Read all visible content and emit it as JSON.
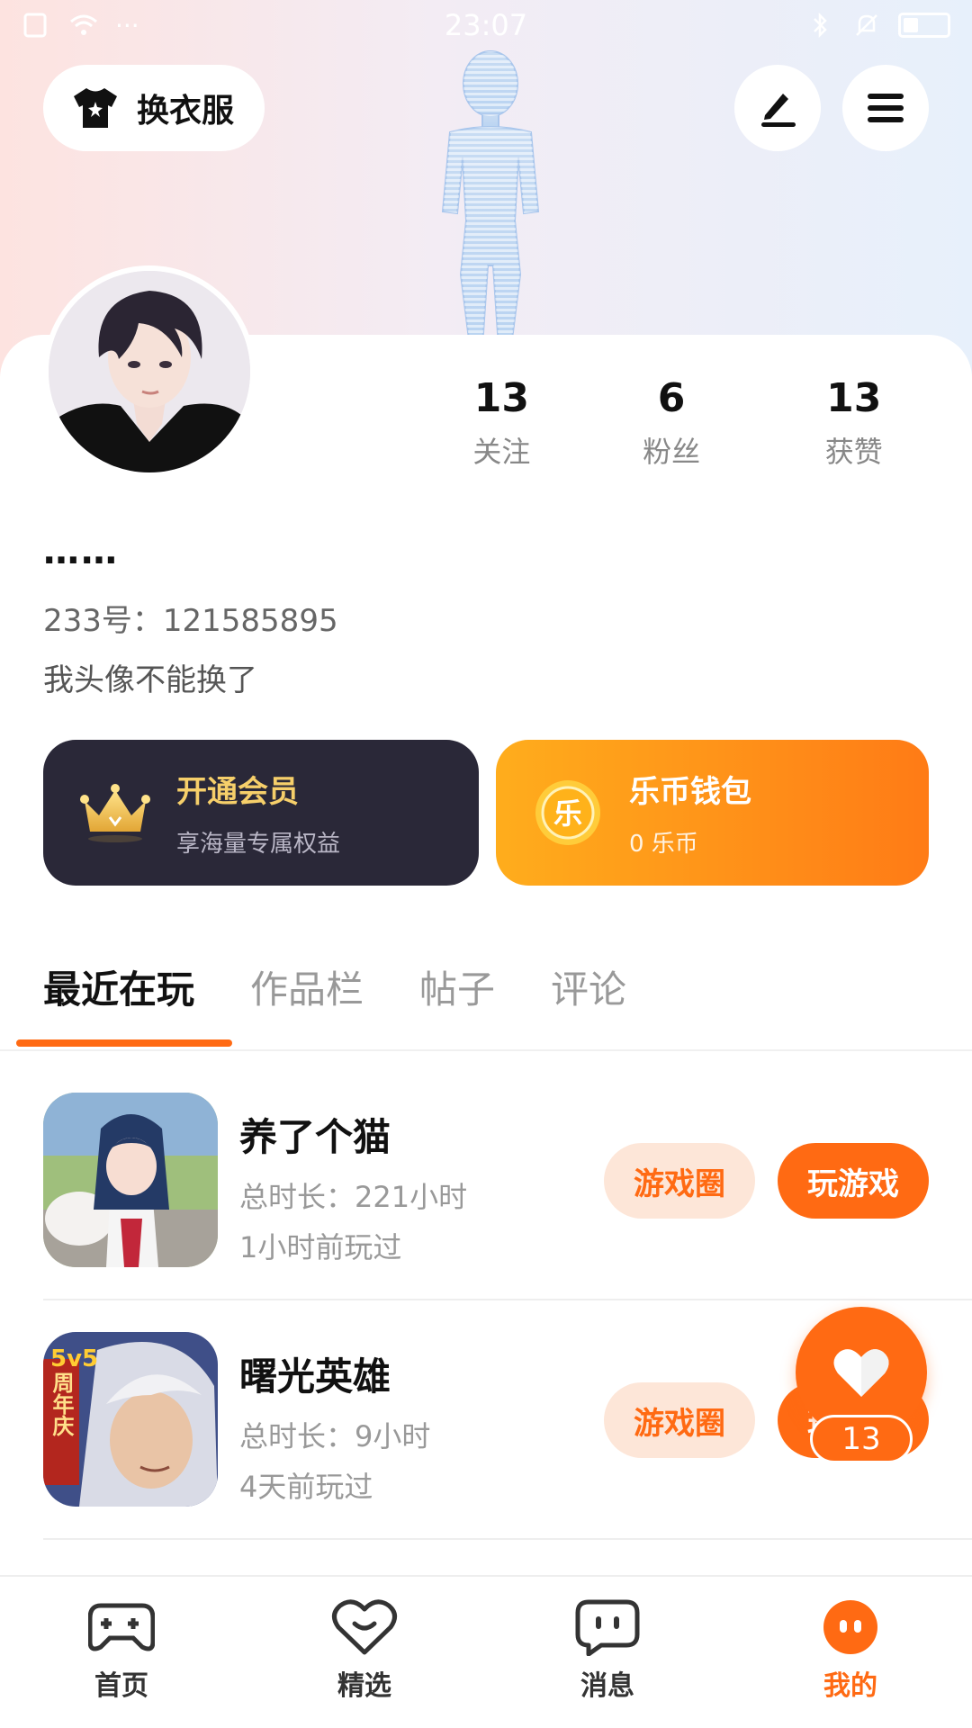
{
  "status_bar": {
    "time": "23:07"
  },
  "top": {
    "outfit_label": "换衣服"
  },
  "stats": [
    {
      "num": "13",
      "label": "关注"
    },
    {
      "num": "6",
      "label": "粉丝"
    },
    {
      "num": "13",
      "label": "获赞"
    }
  ],
  "profile": {
    "nickname": "……",
    "user_id": "233号：121585895",
    "bio": "我头像不能换了"
  },
  "vip_card": {
    "title": "开通会员",
    "subtitle": "享海量专属权益"
  },
  "wallet_card": {
    "title": "乐币钱包",
    "subtitle": "0 乐币",
    "coin_glyph": "乐"
  },
  "tabs": [
    "最近在玩",
    "作品栏",
    "帖子",
    "评论"
  ],
  "games": [
    {
      "name": "养了个猫",
      "duration": "总时长：221小时",
      "last_played": "1小时前玩过",
      "circle_label": "游戏圈",
      "play_label": "玩游戏"
    },
    {
      "name": "曙光英雄",
      "duration": "总时长：9小时",
      "last_played": "4天前玩过",
      "circle_label": "游戏圈",
      "play_label": "玩游戏",
      "icon_badge": "5v5",
      "icon_text": "周年庆"
    }
  ],
  "float_like": {
    "count": "13"
  },
  "nav": [
    {
      "label": "首页",
      "icon": "gamepad-icon"
    },
    {
      "label": "精选",
      "icon": "heart-chat-icon"
    },
    {
      "label": "消息",
      "icon": "message-icon"
    },
    {
      "label": "我的",
      "icon": "profile-face-icon"
    }
  ],
  "colors": {
    "accent": "#ff6a13",
    "vip_bg": "#2a2838",
    "vip_gold": "#f6cf6a"
  }
}
